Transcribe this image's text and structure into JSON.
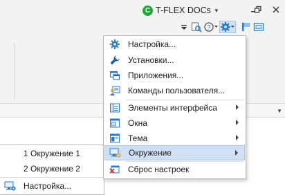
{
  "app": {
    "name": "T-FLEX DOCs",
    "logo_glyph": "C"
  },
  "colors": {
    "accent": "#2a78c6",
    "highlight": "#cfe0f5",
    "logo": "#26a33b"
  },
  "settings_menu": {
    "items": [
      {
        "label": "Настройка...",
        "icon": "gear-icon"
      },
      {
        "label": "Установки...",
        "icon": "wrench-icon"
      },
      {
        "label": "Приложения...",
        "icon": "applications-icon"
      },
      {
        "label": "Команды пользователя...",
        "icon": "user-commands-icon"
      },
      {
        "label": "Элементы интерфейса",
        "icon": "interface-elements-icon",
        "submenu": true
      },
      {
        "label": "Окна",
        "icon": "windows-icon",
        "submenu": true
      },
      {
        "label": "Тема",
        "icon": "theme-icon",
        "submenu": true
      },
      {
        "label": "Окружение",
        "icon": "environment-icon",
        "submenu": true,
        "highlighted": true
      },
      {
        "label": "Сброс настроек",
        "icon": "reset-settings-icon"
      }
    ]
  },
  "environment_submenu": {
    "items": [
      {
        "label": "1 Окружение 1"
      },
      {
        "label": "2 Окружение 2"
      },
      {
        "label": "Настройка...",
        "icon": "environment-settings-icon"
      }
    ]
  }
}
